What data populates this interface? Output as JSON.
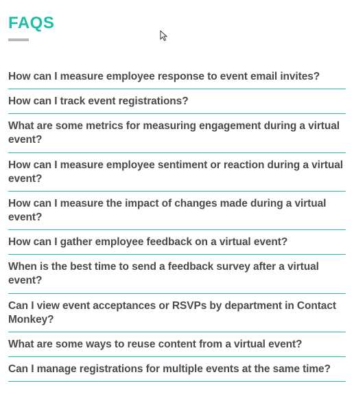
{
  "heading": "FAQS",
  "faq_items": [
    "How can I measure employee response to event email invites?",
    "How can I track event registrations?",
    "What are some metrics for measuring engagement during a virtual event?",
    "How can I measure employee sentiment or reaction during a virtual event?",
    "How can I measure the impact of changes made during a virtual event?",
    "How can I gather employee feedback on a virtual event?",
    "When is the best time to send a feedback survey after a virtual event?",
    "Can I view event acceptances or RSVPs by department in Contact Monkey?",
    "What are some ways to reuse content from a virtual event?",
    "Can I manage registrations for multiple events at the same time?"
  ]
}
